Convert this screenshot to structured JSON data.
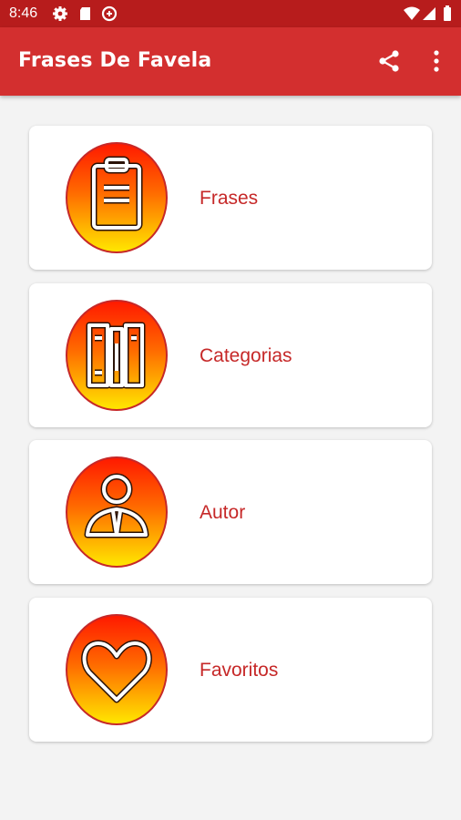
{
  "status_bar": {
    "time": "8:46"
  },
  "app_bar": {
    "title": "Frases De Favela"
  },
  "menu": [
    {
      "label": "Frases",
      "icon": "clipboard-icon"
    },
    {
      "label": "Categorias",
      "icon": "books-icon"
    },
    {
      "label": "Autor",
      "icon": "person-icon"
    },
    {
      "label": "Favoritos",
      "icon": "heart-icon"
    }
  ],
  "colors": {
    "primary": "#d32f2f",
    "primary_dark": "#b71c1c",
    "label": "#c62828",
    "gradient_top": "#ff1a00",
    "gradient_bottom": "#ffe600"
  }
}
